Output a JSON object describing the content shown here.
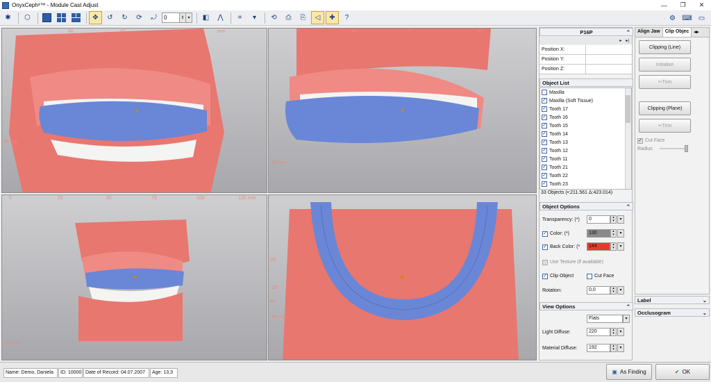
{
  "window": {
    "title": "OnyxCeph³™ - Module Cast Adjust",
    "min": "—",
    "restore": "❐",
    "close": "✕"
  },
  "toolbar": {
    "zoom_value": "0"
  },
  "viewports": {
    "top_left": {
      "ruler_top": [
        "60",
        "40",
        "20",
        "mm"
      ],
      "ruler_left": [
        "40 mm"
      ]
    },
    "top_right": {
      "ruler_top": [
        "0",
        "40",
        "20",
        "40"
      ],
      "ruler_left": [
        "-40 mm"
      ]
    },
    "bottom_left": {
      "ruler_top": [
        "0",
        "25",
        "50",
        "75",
        "100",
        "125 mm"
      ],
      "ruler_left": [
        "-75 mm"
      ]
    },
    "bottom_right": {
      "ruler_left": [
        "20",
        "-20",
        "40",
        "-40 mm"
      ]
    }
  },
  "side": {
    "case_title": "P16P",
    "position": [
      {
        "label": "Position X:"
      },
      {
        "label": "Position Y:"
      },
      {
        "label": "Position Z:"
      }
    ],
    "object_list_title": "Object List",
    "objects": [
      {
        "label": "Maxilla",
        "checked": false
      },
      {
        "label": "Maxilla (Soft Tissue)",
        "checked": true
      },
      {
        "label": "Tooth 17",
        "checked": true
      },
      {
        "label": "Tooth 16",
        "checked": true
      },
      {
        "label": "Tooth 15",
        "checked": true
      },
      {
        "label": "Tooth 14",
        "checked": true
      },
      {
        "label": "Tooth 13",
        "checked": true
      },
      {
        "label": "Tooth 12",
        "checked": true
      },
      {
        "label": "Tooth 11",
        "checked": true
      },
      {
        "label": "Tooth 21",
        "checked": true
      },
      {
        "label": "Tooth 22",
        "checked": true
      },
      {
        "label": "Tooth 23",
        "checked": true
      }
    ],
    "object_count": "33 Objects (•:211.561 Δ:423.014)",
    "object_options_title": "Object Options",
    "transparency_label": "Transparency: (*)",
    "transparency_value": "0",
    "color_label": "Color: (*)",
    "color_value": "130",
    "back_color_label": "Back Color: (*",
    "back_color_value": "144",
    "use_texture_label": "Use Texture   (if available)",
    "clip_object_label": "Clip Object",
    "cut_face_label": "Cut Face",
    "rotation_label": "Rotation:",
    "rotation_value": "0,0",
    "view_options_title": "View Options",
    "flats_value": "Flats",
    "light_diffuse_label": "Light Diffuse:",
    "light_diffuse_value": "220",
    "material_diffuse_label": "Material Diffuse:",
    "material_diffuse_value": "192"
  },
  "right": {
    "tab_align": "Align Jaw",
    "tab_clip": "Clip Objec",
    "btn_clip_line": "Clipping (Line)",
    "btn_initialize": "Initialize",
    "btn_trim1": "Trim",
    "btn_clip_plane": "Clipping (Plane)",
    "btn_trim2": "Trim",
    "cut_face": "Cut Face",
    "radius": "Radius",
    "label_section": "Label",
    "occlusogram_section": "Occlusogram"
  },
  "status": {
    "name": "Name: Demo, Daniela",
    "id": "ID: 10000",
    "date": "Date of Record: 04.07.2007",
    "age": "Age: 13,3",
    "as_finding": "As Finding",
    "ok": "OK"
  },
  "colors": {
    "gum": "#e8776f",
    "aligner": "#6a86d6",
    "tooth": "#f4f4f2",
    "color_swatch": "#8a8a8a",
    "back_swatch": "#e83a2a"
  }
}
